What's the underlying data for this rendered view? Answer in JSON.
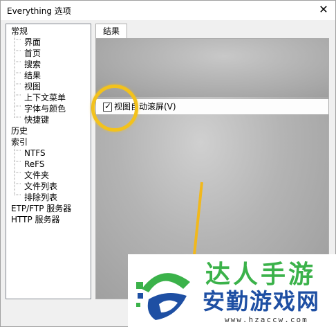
{
  "window": {
    "title": "Everything 选项",
    "close_glyph": "✕"
  },
  "tree": {
    "items": [
      {
        "label": "常规",
        "level": 0
      },
      {
        "label": "界面",
        "level": 1
      },
      {
        "label": "首页",
        "level": 1
      },
      {
        "label": "搜索",
        "level": 1
      },
      {
        "label": "结果",
        "level": 1
      },
      {
        "label": "视图",
        "level": 1
      },
      {
        "label": "上下文菜单",
        "level": 1
      },
      {
        "label": "字体与颜色",
        "level": 1
      },
      {
        "label": "快捷键",
        "level": 1
      },
      {
        "label": "历史",
        "level": 0
      },
      {
        "label": "索引",
        "level": 0
      },
      {
        "label": "NTFS",
        "level": 1
      },
      {
        "label": "ReFS",
        "level": 1
      },
      {
        "label": "文件夹",
        "level": 1
      },
      {
        "label": "文件列表",
        "level": 1
      },
      {
        "label": "排除列表",
        "level": 1
      },
      {
        "label": "ETP/FTP 服务器",
        "level": 0
      },
      {
        "label": "HTTP 服务器",
        "level": 0
      }
    ]
  },
  "tab": {
    "label": "结果"
  },
  "option": {
    "label": "视图自动滚屏(V)",
    "checked": true,
    "check_glyph": "✓"
  },
  "watermark": {
    "top_text": "达人手游",
    "main_text": "安勤游戏网",
    "url": "www.hzaccw.com"
  },
  "colors": {
    "highlight_circle": "#f3c21c",
    "watermark_green": "#3bb24a",
    "watermark_blue": "#1e4fa3"
  }
}
